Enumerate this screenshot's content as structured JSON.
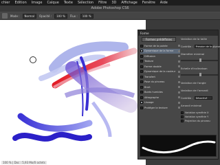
{
  "menubar": {
    "items": [
      "chier",
      "Edition",
      "Image",
      "Calque",
      "Texte",
      "Sélection",
      "Filtre",
      "3D",
      "Affichage",
      "Fenêtre",
      "Aide"
    ]
  },
  "window": {
    "title": "Adobe Photoshop CS6"
  },
  "options_bar": {
    "mode_label": "Mode :",
    "mode_value": "Normal",
    "opacity_label": "Opacité :",
    "opacity_value": "100 %",
    "flow_label": "Flux :",
    "flow_value": "100 %"
  },
  "canvas": {
    "status_text": "100 % | Doc : 5,93 Mo/0 octets"
  },
  "brush_panel": {
    "tab_label": "Forme",
    "presets_button": "Formes prédéfinies",
    "options": [
      {
        "label": "Forme de la pointe",
        "checked": false,
        "selected": false
      },
      {
        "label": "Dynamique de la forme",
        "checked": true,
        "selected": true
      },
      {
        "label": "Diffusion",
        "checked": false,
        "selected": false
      },
      {
        "label": "Texture",
        "checked": false,
        "selected": false
      },
      {
        "label": "Forme double",
        "checked": false,
        "selected": false
      },
      {
        "label": "Dynamique de la couleur",
        "checked": false,
        "selected": false
      },
      {
        "label": "Transfert",
        "checked": false,
        "selected": false
      },
      {
        "label": "Pose du pinceau",
        "checked": false,
        "selected": false
      },
      {
        "label": "Bruit",
        "checked": false,
        "selected": false
      },
      {
        "label": "Bords humides",
        "checked": false,
        "selected": false
      },
      {
        "label": "Aérographe",
        "checked": false,
        "selected": false
      },
      {
        "label": "Lissage",
        "checked": true,
        "selected": false
      },
      {
        "label": "Protéger la texture",
        "checked": false,
        "selected": false
      }
    ],
    "right": {
      "size_jitter": "Variation de la taille",
      "control_label": "Contrôle :",
      "control_value": "Pression de la plume",
      "min_diameter": "Diamètre minimal",
      "tilt_scale": "Echelle d'inclinaison",
      "angle_jitter": "Variation de l'angle",
      "roundness_jitter": "Variation de l'arrondi",
      "min_roundness": "Arrondi minimal",
      "control2_label": "Contrôle :",
      "control2_value": "Désactivé",
      "flip_x": "Variation symétrie X",
      "flip_y": "Variation symétrie Y",
      "brush_projection": "Projection du pinceau"
    }
  }
}
